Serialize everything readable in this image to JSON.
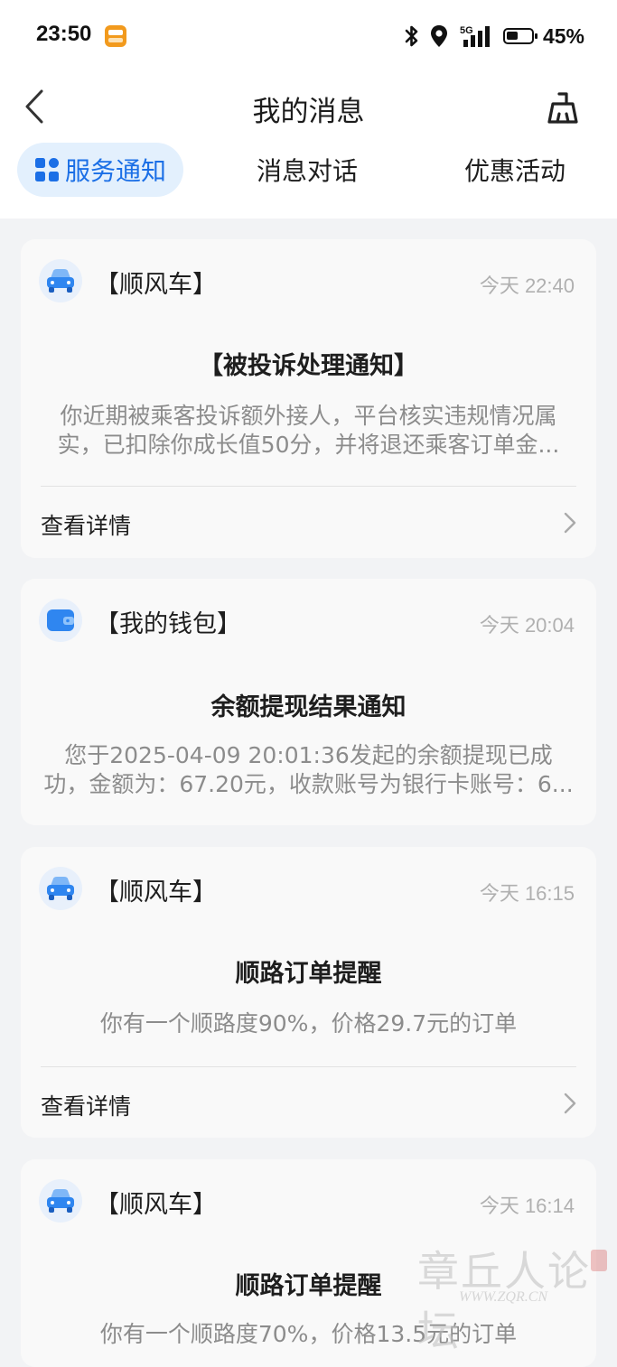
{
  "status_bar": {
    "time": "23:50",
    "battery_percent": "45%",
    "network": "5G"
  },
  "header": {
    "title": "我的消息",
    "back_icon": "chevron-left-icon",
    "clean_icon": "broom-icon"
  },
  "tabs": [
    {
      "label": "服务通知",
      "active": true,
      "icon": "grid-icon"
    },
    {
      "label": "消息对话",
      "active": false
    },
    {
      "label": "优惠活动",
      "active": false
    }
  ],
  "colors": {
    "accent": "#1b6fe6",
    "tab_active_bg": "#e3f0fd",
    "page_bg": "#f2f3f5",
    "card_bg": "#f9f9f9"
  },
  "messages": [
    {
      "source": "【顺风车】",
      "time": "今天 22:40",
      "icon": "car-icon",
      "title": "【被投诉处理通知】",
      "body_lines": [
        "你近期被乘客投诉额外接人，平台核实违规情况属",
        "实，已扣除你成长值50分，并将退还乘客订单金..."
      ],
      "detail_label": "查看详情"
    },
    {
      "source": "【我的钱包】",
      "time": "今天 20:04",
      "icon": "wallet-icon",
      "title": "余额提现结果通知",
      "body_lines": [
        "您于2025-04-09 20:01:36发起的余额提现已成",
        "功，金额为：67.20元，收款账号为银行卡账号：6..."
      ]
    },
    {
      "source": "【顺风车】",
      "time": "今天 16:15",
      "icon": "car-icon",
      "title": "顺路订单提醒",
      "body_lines": [
        "你有一个顺路度90%，价格29.7元的订单"
      ],
      "detail_label": "查看详情"
    },
    {
      "source": "【顺风车】",
      "time": "今天 16:14",
      "icon": "car-icon",
      "title": "顺路订单提醒",
      "body_lines": [
        "你有一个顺路度70%，价格13.5元的订单"
      ]
    }
  ],
  "watermark": {
    "text": "章丘人论坛",
    "url": "WWW.ZQR.CN"
  }
}
